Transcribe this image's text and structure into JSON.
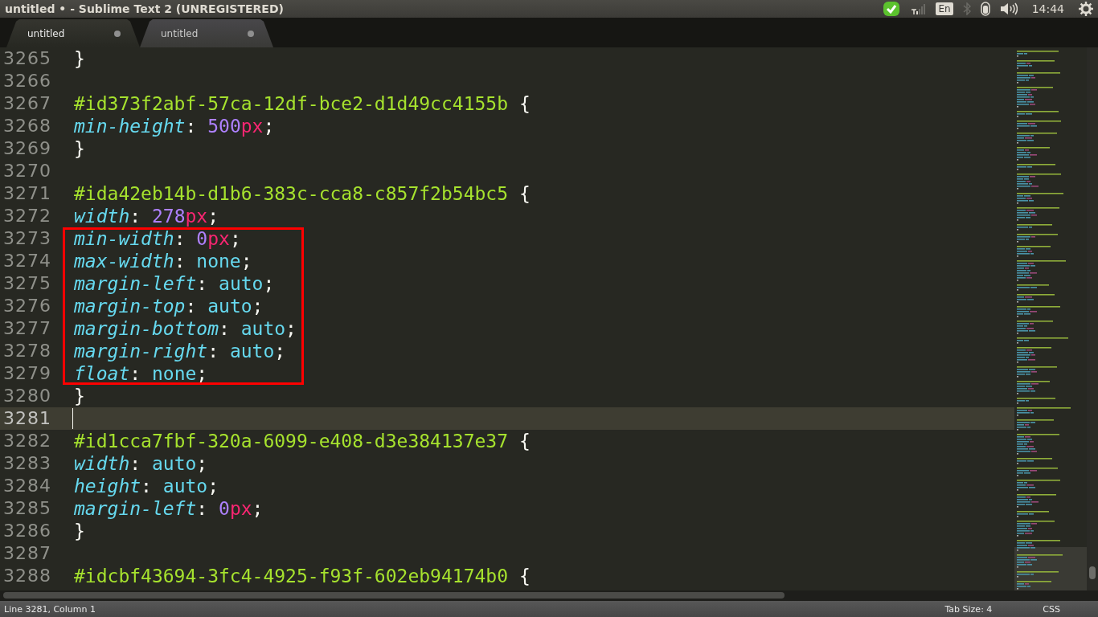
{
  "window": {
    "title": "untitled • - Sublime Text 2 (UNREGISTERED)"
  },
  "tray": {
    "keyboard": "En",
    "clock": "14:44"
  },
  "tabs": [
    {
      "label": "untitled",
      "selected": true,
      "modified": true
    },
    {
      "label": "untitled",
      "selected": false,
      "modified": true
    }
  ],
  "lines": [
    {
      "number": "3265",
      "current": false,
      "boxed": false,
      "tokens": [
        {
          "kind": "punct",
          "text": "}"
        }
      ]
    },
    {
      "number": "3266",
      "current": false,
      "boxed": false
    },
    {
      "number": "3267",
      "current": false,
      "boxed": false,
      "tokens": [
        {
          "kind": "selector",
          "text": "#id373f2abf-57ca-12df-bce2-d1d49cc4155b"
        },
        {
          "kind": "punct",
          "text": " {"
        }
      ]
    },
    {
      "number": "3268",
      "current": false,
      "boxed": false,
      "tokens": [
        {
          "kind": "property",
          "text": "min-height"
        },
        {
          "kind": "punct",
          "text": ": "
        },
        {
          "kind": "number",
          "text": "500"
        },
        {
          "kind": "unit",
          "text": "px"
        },
        {
          "kind": "punct",
          "text": ";"
        }
      ]
    },
    {
      "number": "3269",
      "current": false,
      "boxed": false,
      "tokens": [
        {
          "kind": "punct",
          "text": "}"
        }
      ]
    },
    {
      "number": "3270",
      "current": false,
      "boxed": false
    },
    {
      "number": "3271",
      "current": false,
      "boxed": false,
      "tokens": [
        {
          "kind": "selector",
          "text": "#ida42eb14b-d1b6-383c-cca8-c857f2b54bc5"
        },
        {
          "kind": "punct",
          "text": " {"
        }
      ]
    },
    {
      "number": "3272",
      "current": false,
      "boxed": false,
      "tokens": [
        {
          "kind": "property",
          "text": "width"
        },
        {
          "kind": "punct",
          "text": ": "
        },
        {
          "kind": "number",
          "text": "278"
        },
        {
          "kind": "unit",
          "text": "px"
        },
        {
          "kind": "punct",
          "text": ";"
        }
      ]
    },
    {
      "number": "3273",
      "current": false,
      "boxed": true,
      "tokens": [
        {
          "kind": "property",
          "text": "min-width"
        },
        {
          "kind": "punct",
          "text": ": "
        },
        {
          "kind": "number",
          "text": "0"
        },
        {
          "kind": "unit",
          "text": "px"
        },
        {
          "kind": "punct",
          "text": ";"
        }
      ]
    },
    {
      "number": "3274",
      "current": false,
      "boxed": true,
      "tokens": [
        {
          "kind": "property",
          "text": "max-width"
        },
        {
          "kind": "punct",
          "text": ": "
        },
        {
          "kind": "value",
          "text": "none"
        },
        {
          "kind": "punct",
          "text": ";"
        }
      ]
    },
    {
      "number": "3275",
      "current": false,
      "boxed": true,
      "tokens": [
        {
          "kind": "property",
          "text": "margin-left"
        },
        {
          "kind": "punct",
          "text": ": "
        },
        {
          "kind": "value",
          "text": "auto"
        },
        {
          "kind": "punct",
          "text": ";"
        }
      ]
    },
    {
      "number": "3276",
      "current": false,
      "boxed": true,
      "tokens": [
        {
          "kind": "property",
          "text": "margin-top"
        },
        {
          "kind": "punct",
          "text": ": "
        },
        {
          "kind": "value",
          "text": "auto"
        },
        {
          "kind": "punct",
          "text": ";"
        }
      ]
    },
    {
      "number": "3277",
      "current": false,
      "boxed": true,
      "tokens": [
        {
          "kind": "property",
          "text": "margin-bottom"
        },
        {
          "kind": "punct",
          "text": ": "
        },
        {
          "kind": "value",
          "text": "auto"
        },
        {
          "kind": "punct",
          "text": ";"
        }
      ]
    },
    {
      "number": "3278",
      "current": false,
      "boxed": true,
      "tokens": [
        {
          "kind": "property",
          "text": "margin-right"
        },
        {
          "kind": "punct",
          "text": ": "
        },
        {
          "kind": "value",
          "text": "auto"
        },
        {
          "kind": "punct",
          "text": ";"
        }
      ]
    },
    {
      "number": "3279",
      "current": false,
      "boxed": true,
      "tokens": [
        {
          "kind": "property",
          "text": "float"
        },
        {
          "kind": "punct",
          "text": ": "
        },
        {
          "kind": "value",
          "text": "none"
        },
        {
          "kind": "punct",
          "text": ";"
        }
      ]
    },
    {
      "number": "3280",
      "current": false,
      "boxed": false,
      "tokens": [
        {
          "kind": "punct",
          "text": "}"
        }
      ]
    },
    {
      "number": "3281",
      "current": true,
      "boxed": false
    },
    {
      "number": "3282",
      "current": false,
      "boxed": false,
      "tokens": [
        {
          "kind": "selector",
          "text": "#id1cca7fbf-320a-6099-e408-d3e384137e37"
        },
        {
          "kind": "punct",
          "text": " {"
        }
      ]
    },
    {
      "number": "3283",
      "current": false,
      "boxed": false,
      "tokens": [
        {
          "kind": "property",
          "text": "width"
        },
        {
          "kind": "punct",
          "text": ": "
        },
        {
          "kind": "value",
          "text": "auto"
        },
        {
          "kind": "punct",
          "text": ";"
        }
      ]
    },
    {
      "number": "3284",
      "current": false,
      "boxed": false,
      "tokens": [
        {
          "kind": "property",
          "text": "height"
        },
        {
          "kind": "punct",
          "text": ": "
        },
        {
          "kind": "value",
          "text": "auto"
        },
        {
          "kind": "punct",
          "text": ";"
        }
      ]
    },
    {
      "number": "3285",
      "current": false,
      "boxed": false,
      "tokens": [
        {
          "kind": "property",
          "text": "margin-left"
        },
        {
          "kind": "punct",
          "text": ": "
        },
        {
          "kind": "number",
          "text": "0"
        },
        {
          "kind": "unit",
          "text": "px"
        },
        {
          "kind": "punct",
          "text": ";"
        }
      ]
    },
    {
      "number": "3286",
      "current": false,
      "boxed": false,
      "tokens": [
        {
          "kind": "punct",
          "text": "}"
        }
      ]
    },
    {
      "number": "3287",
      "current": false,
      "boxed": false
    },
    {
      "number": "3288",
      "current": false,
      "boxed": false,
      "tokens": [
        {
          "kind": "selector",
          "text": "#idcbf43694-3fc4-4925-f93f-602eb94174b0"
        },
        {
          "kind": "punct",
          "text": " {"
        }
      ]
    }
  ],
  "status_bar": {
    "position": "Line 3281, Column 1",
    "tab_size": "Tab Size: 4",
    "syntax": "CSS"
  }
}
